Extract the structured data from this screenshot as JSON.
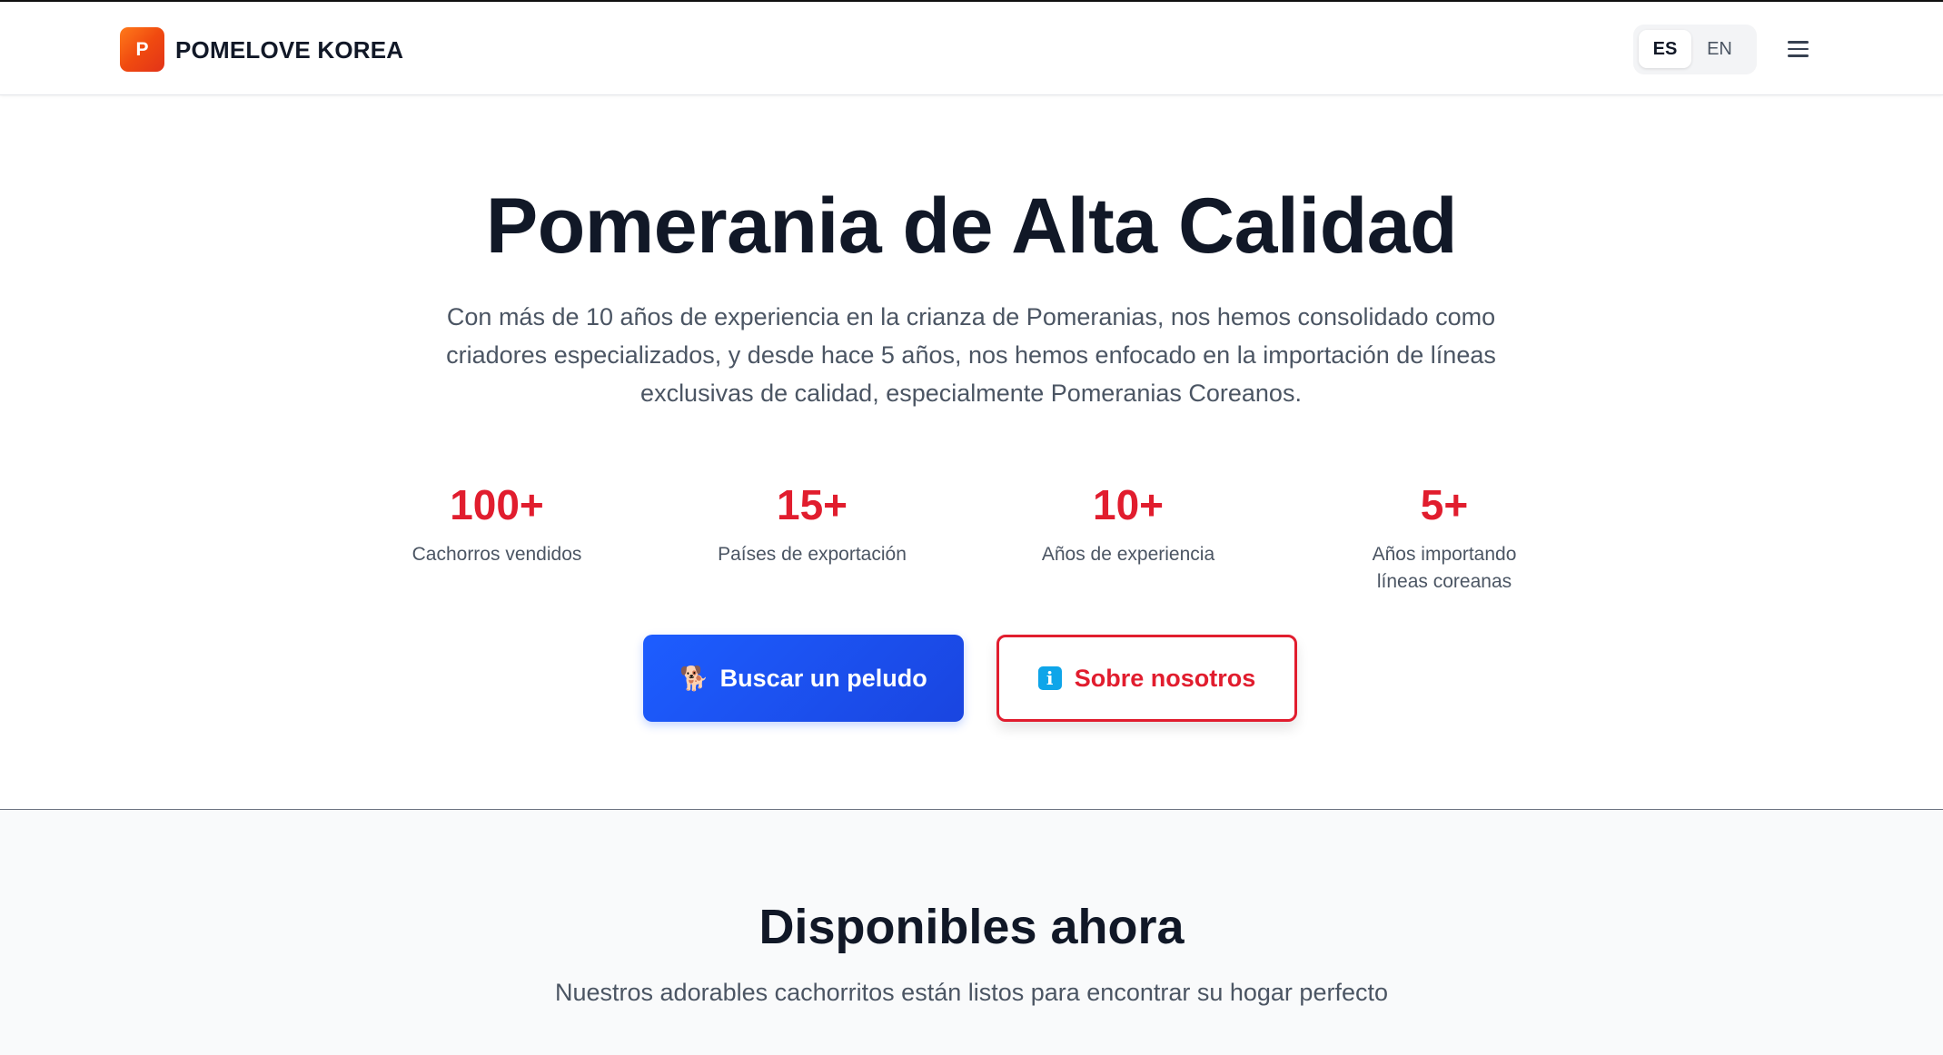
{
  "header": {
    "logo_letter": "P",
    "brand": "POMELOVE KOREA",
    "languages": [
      {
        "code": "ES",
        "active": true
      },
      {
        "code": "EN",
        "active": false
      }
    ]
  },
  "hero": {
    "title": "Pomerania de Alta Calidad",
    "description": "Con más de 10 años de experiencia en la crianza de Pomeranias, nos hemos consolidado como criadores especializados, y desde hace 5 años, nos hemos enfocado en la importación de líneas exclusivas de calidad, especialmente Pomeranias Coreanos.",
    "stats": [
      {
        "value": "100+",
        "label": "Cachorros vendidos"
      },
      {
        "value": "15+",
        "label": "Países de exportación"
      },
      {
        "value": "10+",
        "label": "Años de experiencia"
      },
      {
        "value": "5+",
        "label": "Años importando líneas coreanas"
      }
    ],
    "primary_button": {
      "icon": "🐕",
      "label": "Buscar un peludo"
    },
    "secondary_button": {
      "icon": "i",
      "label": "Sobre nosotros"
    }
  },
  "available": {
    "title": "Disponibles ahora",
    "subtitle": "Nuestros adorables cachorritos están listos para encontrar su hogar perfecto"
  },
  "colors": {
    "accent_red": "#e11d2e",
    "primary_blue": "#1d5dff",
    "logo_orange": "#f04a10"
  }
}
